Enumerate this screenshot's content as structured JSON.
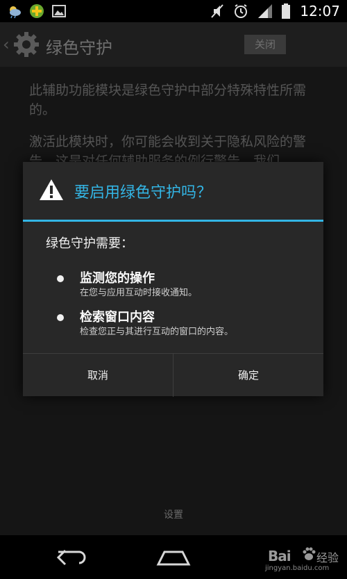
{
  "status_bar": {
    "time": "12:07",
    "left_icons": [
      "weather-icon",
      "plus-app-icon",
      "image-icon"
    ],
    "right_icons": [
      "mute-icon",
      "alarm-icon",
      "signal-icon",
      "battery-icon"
    ]
  },
  "app": {
    "title": "绿色守护",
    "toggle_label": "关闭",
    "description": [
      "此辅助功能模块是绿色守护中部分特殊特性所需的。",
      "激活此模块时，你可能会收到关于隐私风险的警告，这是对任何辅助服务的例行警告。我们"
    ],
    "bottom_label": "设置"
  },
  "dialog": {
    "title": "要启用绿色守护吗？",
    "intro": "绿色守护需要：",
    "permissions": [
      {
        "title": "监测您的操作",
        "desc": "在您与应用互动时接收通知。"
      },
      {
        "title": "检索窗口内容",
        "desc": "检查您正与其进行互动的窗口的内容。"
      }
    ],
    "cancel_label": "取消",
    "ok_label": "确定"
  },
  "watermark": {
    "brand": "Bai",
    "cn": "经验",
    "url": "jingyan.baidu.com"
  },
  "colors": {
    "accent": "#33b5e5",
    "dialog_bg": "#282828"
  }
}
